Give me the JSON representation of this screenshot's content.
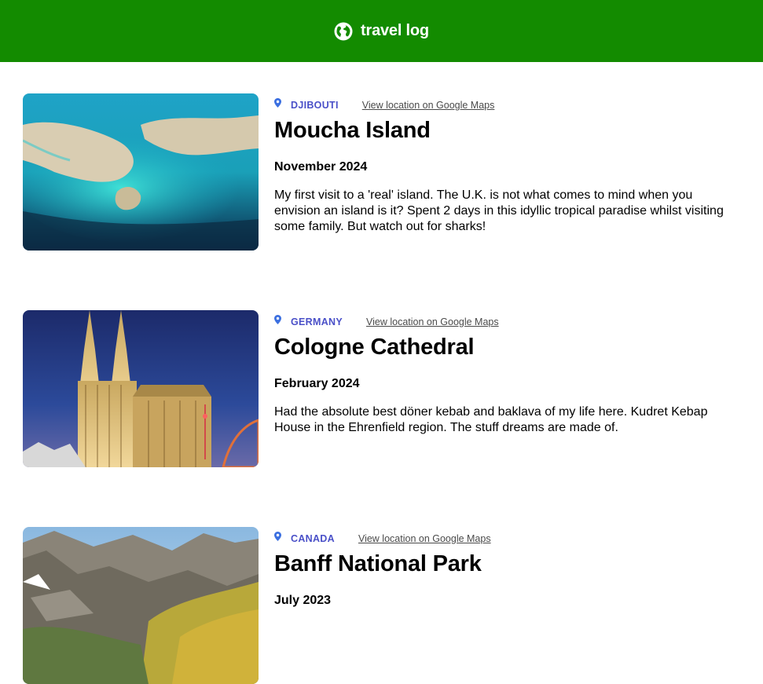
{
  "header": {
    "title": "travel log",
    "icon": "globe-icon",
    "background_color": "#138b00"
  },
  "entries": [
    {
      "country": "DJIBOUTI",
      "map_link": "View location on Google Maps",
      "title": "Moucha Island",
      "date": "November 2024",
      "description": "My first visit to a 'real' island. The U.K. is not what comes to mind when you envision an island is it? Spent 2 days in this idyllic tropical paradise whilst visiting some family. But watch out for sharks!",
      "image": "aerial-island-photo"
    },
    {
      "country": "GERMANY",
      "map_link": "View location on Google Maps",
      "title": "Cologne Cathedral",
      "date": "February 2024",
      "description": "Had the absolute best döner kebab and baklava of my life here. Kudret Kebap House in the Ehrenfield region. The stuff dreams are made of.",
      "image": "cathedral-night-photo"
    },
    {
      "country": "CANADA",
      "map_link": "View location on Google Maps",
      "title": "Banff National Park",
      "date": "July 2023",
      "description": "",
      "image": "mountain-valley-photo"
    }
  ],
  "colors": {
    "accent": "#138b00",
    "country": "#4a50c8"
  }
}
